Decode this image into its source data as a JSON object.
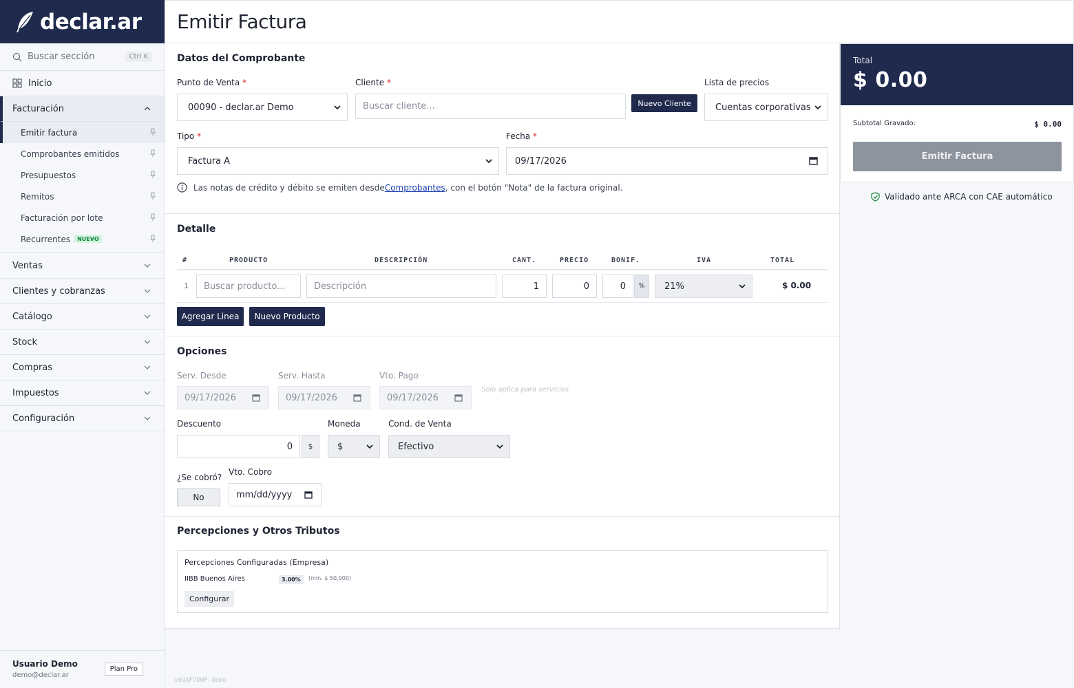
{
  "brand": {
    "name": "declar.ar"
  },
  "sidebar": {
    "search_placeholder": "Buscar sección",
    "search_shortcut": "Ctrl K",
    "home_label": "Inicio",
    "sections": [
      {
        "label": "Facturación"
      },
      {
        "label": "Ventas"
      },
      {
        "label": "Clientes y cobranzas"
      },
      {
        "label": "Catálogo"
      },
      {
        "label": "Stock"
      },
      {
        "label": "Compras"
      },
      {
        "label": "Impuestos"
      },
      {
        "label": "Configuración"
      }
    ],
    "facturacion_items": [
      {
        "label": "Emitir factura"
      },
      {
        "label": "Comprobantes emitidos"
      },
      {
        "label": "Presupuestos"
      },
      {
        "label": "Remitos"
      },
      {
        "label": "Facturación por lote"
      },
      {
        "label": "Recurrentes"
      }
    ],
    "new_badge": "NUEVO",
    "user": {
      "name": "Usuario Demo",
      "email": "demo@declar.ar",
      "plan": "Plan Pro"
    }
  },
  "header": {
    "title": "Emitir Factura"
  },
  "comprobante": {
    "title": "Datos del Comprobante",
    "punto_venta_label": "Punto de Venta",
    "punto_venta_value": "00090 - declar.ar Demo",
    "cliente_label": "Cliente",
    "cliente_placeholder": "Buscar cliente...",
    "nuevo_cliente": "Nuevo Cliente",
    "lista_precios_label": "Lista de precios",
    "lista_precios_value": "Cuentas corporativas",
    "tipo_label": "Tipo",
    "tipo_value": "Factura A",
    "fecha_label": "Fecha",
    "fecha_value": "09/17/2026",
    "required_mark": "*",
    "note_before": "Las notas de crédito y débito se emiten desde ",
    "note_link": "Comprobantes",
    "note_after": ", con el botón \"Nota\" de la factura original."
  },
  "detalle": {
    "title": "Detalle",
    "columns": [
      "#",
      "PRODUCTO",
      "DESCRIPCIÓN",
      "CANT.",
      "PRECIO",
      "BONIF.",
      "IVA",
      "TOTAL"
    ],
    "row": {
      "index": "1",
      "producto_placeholder": "Buscar producto...",
      "descripcion_placeholder": "Descripción",
      "cantidad": "1",
      "precio": "0",
      "bonif": "0",
      "bonif_unit": "%",
      "iva": "21%",
      "total": "$ 0.00"
    },
    "add_line": "Agregar Linea",
    "new_product": "Nuevo Producto"
  },
  "opciones": {
    "title": "Opciones",
    "serv_desde_label": "Serv. Desde",
    "serv_desde_value": "09/17/2026",
    "serv_hasta_label": "Serv. Hasta",
    "serv_hasta_value": "09/17/2026",
    "vto_pago_label": "Vto. Pago",
    "vto_pago_value": "09/17/2026",
    "servicios_hint": "Solo aplica para servicios",
    "descuento_label": "Descuento",
    "descuento_value": "0",
    "descuento_unit": "$",
    "moneda_label": "Moneda",
    "moneda_value": "$",
    "cond_venta_label": "Cond. de Venta",
    "cond_venta_value": "Efectivo",
    "se_cobro_label": "¿Se cobró?",
    "se_cobro_value": "No",
    "vto_cobro_label": "Vto. Cobro",
    "vto_cobro_placeholder": "mm/dd/yyyy"
  },
  "percepciones": {
    "title": "Percepciones y Otros Tributos",
    "box_title": "Percepciones Configuradas (Empresa)",
    "item_name": "IIBB Buenos Aires",
    "item_rate": "3.00%",
    "item_min": "(min. $ 50,000)",
    "configure": "Configurar"
  },
  "summary": {
    "total_label": "Total",
    "total_value": "$ 0.00",
    "subtotal_label": "Subtotal Gravado:",
    "subtotal_value": "$ 0.00",
    "emit_button": "Emitir Factura",
    "validated": "Validado ante ARCA con CAE automático"
  },
  "version": "v0UAF7DWF-demo",
  "colors": {
    "primary": "#1f2a4d",
    "disabled_button": "#8e949f",
    "required": "#dc2626",
    "link": "#1e40af",
    "badge_new": "#15803d"
  }
}
